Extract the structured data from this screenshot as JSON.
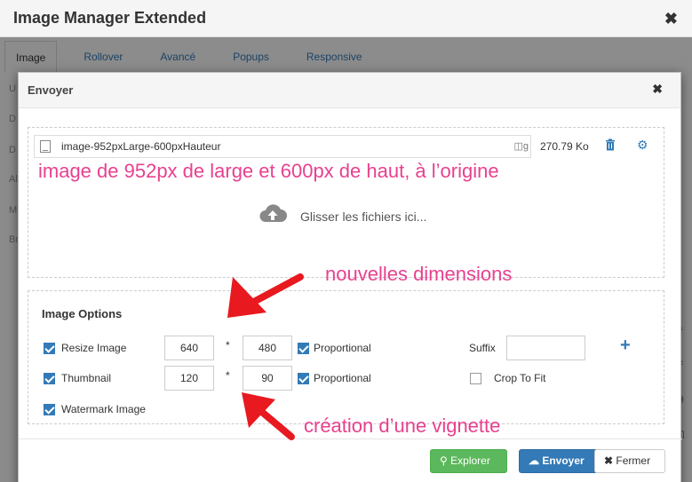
{
  "outer_window": {
    "title": "Image Manager Extended",
    "close_icon": "close-icon",
    "tabs": [
      "Image",
      "Rollover",
      "Avancé",
      "Popups",
      "Responsive"
    ],
    "active_tab": "Image",
    "side_letters": [
      "U",
      "D",
      "D",
      "Al",
      "M",
      "Bo"
    ]
  },
  "modal": {
    "title": "Envoyer",
    "close_icon": "close-icon",
    "file": {
      "name": "image-952pxLarge-600pxHauteur",
      "size": "270.79 Ko",
      "type_icon": "image-file-icon"
    },
    "dropzone_text": "Glisser les fichiers ici...",
    "options": {
      "title": "Image Options",
      "resize": {
        "label": "Resize Image",
        "checked": true,
        "width": "640",
        "height": "480",
        "proportional_label": "Proportional",
        "proportional_checked": true
      },
      "thumbnail": {
        "label": "Thumbnail",
        "checked": true,
        "width": "120",
        "height": "90",
        "proportional_label": "Proportional",
        "proportional_checked": true
      },
      "watermark": {
        "label": "Watermark Image",
        "checked": true
      },
      "suffix_label": "Suffix",
      "suffix_value": "",
      "crop_label": "Crop To Fit",
      "crop_checked": false,
      "times": "*"
    },
    "buttons": {
      "explorer": "Explorer",
      "envoyer": "Envoyer",
      "fermer": "Fermer"
    }
  },
  "annotations": {
    "original": "image de 952px de large et 600px de haut, à l’origine",
    "new_dims": "nouvelles dimensions",
    "thumbnail": "création d’une vignette"
  },
  "colors": {
    "primary": "#337ab7",
    "success": "#5cb85c",
    "annotation": "#e8418f",
    "arrow": "#e8191f"
  }
}
